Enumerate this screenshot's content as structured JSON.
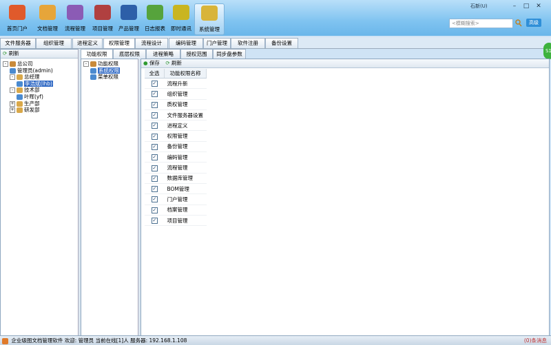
{
  "nav": [
    {
      "label": "首页门户",
      "icon": "house-icon",
      "color": "#e05a2b"
    },
    {
      "label": "文档管理",
      "icon": "folder-icon",
      "color": "#e6a53a"
    },
    {
      "label": "流程管理",
      "icon": "workflow-icon",
      "color": "#8b5bb5"
    },
    {
      "label": "项目管理",
      "icon": "books-icon",
      "color": "#b04040"
    },
    {
      "label": "产品管理",
      "icon": "globe-icon",
      "color": "#2d5fa8"
    },
    {
      "label": "日志报表",
      "icon": "report-icon",
      "color": "#56a33c"
    },
    {
      "label": "即时通讯",
      "icon": "chat-icon",
      "color": "#c9b520"
    },
    {
      "label": "系统管理",
      "icon": "settings-icon",
      "color": "#d8b43a"
    }
  ],
  "header": {
    "user": "石新(U)",
    "search_placeholder": "<模糊搜索>",
    "advanced": "高级"
  },
  "module_tabs": [
    "文件服务器",
    "组织管理",
    "进程定义",
    "权限管理",
    "流程设计",
    "编码管理",
    "门户管理",
    "软件注册",
    "备份设置"
  ],
  "active_module_tab": 3,
  "sub_tabs": [
    "功能权限",
    "底层权限",
    "进程策略",
    "授权范围",
    "同步盘参数"
  ],
  "left": {
    "refresh": "刷新",
    "tree": [
      {
        "label": "总公司",
        "level": 0,
        "exp": "-"
      },
      {
        "label": "管理员(admin)",
        "level": 1,
        "exp": ""
      },
      {
        "label": "总经理",
        "level": 1,
        "exp": "-"
      },
      {
        "label": "李浩斌(lhb)",
        "level": 2,
        "exp": "",
        "selected": true
      },
      {
        "label": "技术部",
        "level": 1,
        "exp": "-"
      },
      {
        "label": "叶晖(yf)",
        "level": 2,
        "exp": ""
      },
      {
        "label": "生产部",
        "level": 1,
        "exp": "+"
      },
      {
        "label": "研发部",
        "level": 1,
        "exp": "+"
      }
    ]
  },
  "middle": {
    "tree": [
      {
        "label": "功能权限",
        "level": 0,
        "exp": "-"
      },
      {
        "label": "系统权限",
        "level": 1,
        "exp": "",
        "selected": true
      },
      {
        "label": "菜单权限",
        "level": 1,
        "exp": ""
      }
    ]
  },
  "right": {
    "save": "保存",
    "refresh": "刷新",
    "col_all": "全选",
    "col_name": "功能权限名称",
    "rows": [
      "流程升新",
      "组织管理",
      "质权管理",
      "文件服务器设置",
      "进程定义",
      "权限管理",
      "备份管理",
      "编码管理",
      "流程管理",
      "数据库管理",
      "BOM管理",
      "门户管理",
      "档案管理",
      "项目管理"
    ]
  },
  "status": {
    "text": "企业级图文档管理软件 欢迎: 管理员 当前在线[1]人 服务器: 192.168.1.108",
    "right": "(0)条消息"
  },
  "side_button": "S1"
}
